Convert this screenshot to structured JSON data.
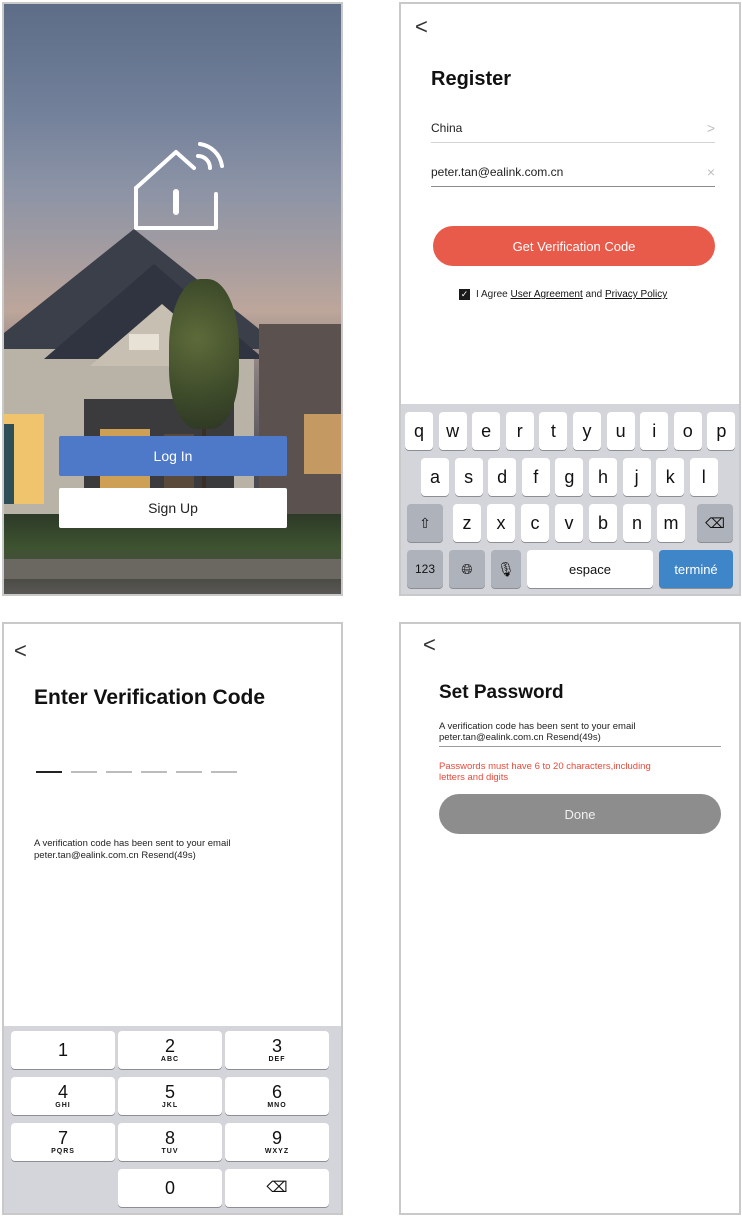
{
  "splash": {
    "login_label": "Log In",
    "signup_label": "Sign Up"
  },
  "register": {
    "back_glyph": "<",
    "title": "Register",
    "country": "China",
    "country_arrow": ">",
    "email": "peter.tan@ealink.com.cn",
    "clear_glyph": "×",
    "verify_button": "Get Verification Code",
    "agree_text": "I Agree",
    "user_agreement": "User Agreement",
    "and_text": "and",
    "privacy_policy": "Privacy Policy",
    "keyboard": {
      "row1": [
        "q",
        "w",
        "e",
        "r",
        "t",
        "y",
        "u",
        "i",
        "o",
        "p"
      ],
      "row2": [
        "a",
        "s",
        "d",
        "f",
        "g",
        "h",
        "j",
        "k",
        "l"
      ],
      "row3": [
        "z",
        "x",
        "c",
        "v",
        "b",
        "n",
        "m"
      ],
      "numbers_key": "123",
      "space_key": "espace",
      "done_key": "terminé"
    }
  },
  "verification": {
    "back_glyph": "<",
    "title": "Enter Verification Code",
    "message_line1": "A verification code has been sent to your email",
    "message_line2": "peter.tan@ealink.com.cn Resend(49s)",
    "numpad": [
      {
        "digit": "1",
        "letters": ""
      },
      {
        "digit": "2",
        "letters": "ABC"
      },
      {
        "digit": "3",
        "letters": "DEF"
      },
      {
        "digit": "4",
        "letters": "GHI"
      },
      {
        "digit": "5",
        "letters": "JKL"
      },
      {
        "digit": "6",
        "letters": "MNO"
      },
      {
        "digit": "7",
        "letters": "PQRS"
      },
      {
        "digit": "8",
        "letters": "TUV"
      },
      {
        "digit": "9",
        "letters": "WXYZ"
      },
      {
        "digit": "0",
        "letters": ""
      }
    ]
  },
  "password": {
    "back_glyph": "<",
    "title": "Set Password",
    "message_line1": "A verification code has been sent to your email",
    "message_line2": "peter.tan@ealink.com.cn Resend(49s)",
    "error_line1": "Passwords must have 6 to 20 characters,including",
    "error_line2": "letters and digits",
    "done_button": "Done"
  },
  "colors": {
    "login_blue": "#4e79c9",
    "verify_red": "#e85a4a",
    "error_red": "#e84a3c",
    "done_gray": "#8d8d8d",
    "keyboard_blue": "#3f86c9"
  }
}
